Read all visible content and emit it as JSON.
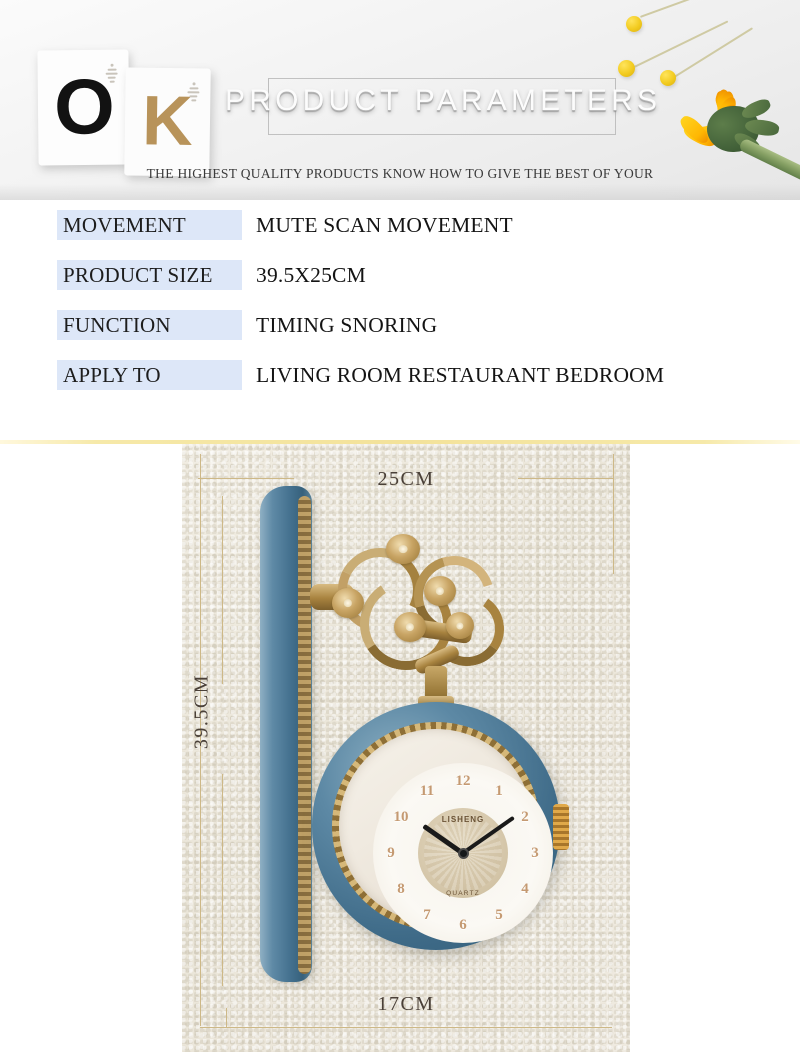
{
  "banner": {
    "card_left_letter": "O",
    "card_right_letter": "K",
    "title": "PRODUCT PARAMETERS",
    "subtitle": "THE HIGHEST QUALITY PRODUCTS KNOW HOW TO GIVE THE BEST OF YOUR"
  },
  "specs": {
    "rows": [
      {
        "label": "MOVEMENT",
        "value": "MUTE SCAN MOVEMENT"
      },
      {
        "label": "PRODUCT SIZE",
        "value": "39.5X25CM"
      },
      {
        "label": "FUNCTION",
        "value": "TIMING SNORING"
      },
      {
        "label": "APPLY TO",
        "value": "LIVING ROOM RESTAURANT BEDROOM"
      }
    ]
  },
  "product_image": {
    "dimension_top": "25CM",
    "dimension_left": "39.5CM",
    "dimension_bottom": "17CM",
    "clock": {
      "brand": "LISHENG",
      "movement_text": "QUARTZ",
      "numerals": [
        "12",
        "1",
        "2",
        "3",
        "4",
        "5",
        "6",
        "7",
        "8",
        "9",
        "10",
        "11"
      ]
    }
  },
  "colors": {
    "label_background": "#dde7f8",
    "gold_rule": "#f3e29a",
    "clock_blue": "#3f6b88",
    "clock_gold": "#c8a464",
    "paper_beige": "#efeae0",
    "flower_yellow": "#f2cb1f"
  }
}
